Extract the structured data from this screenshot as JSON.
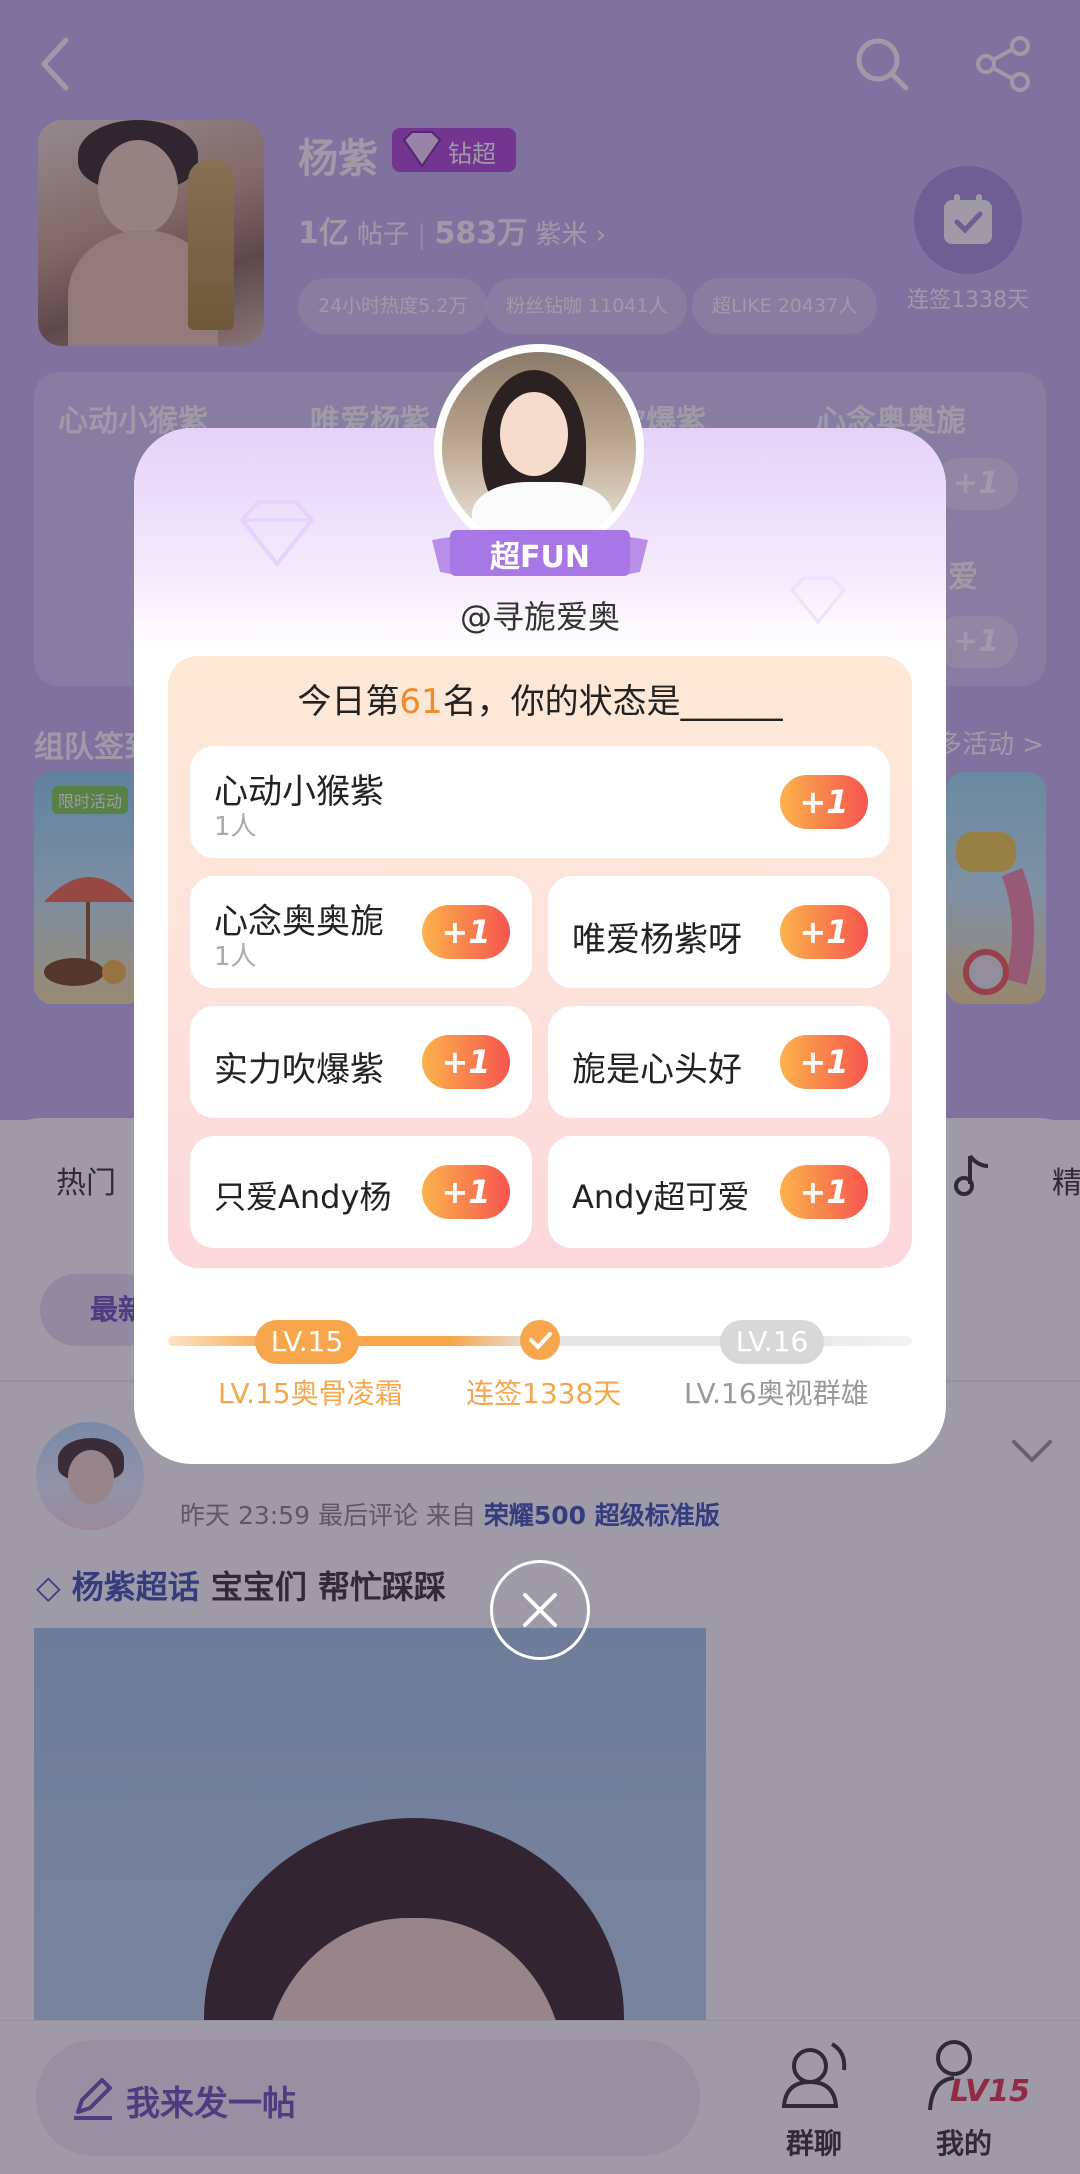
{
  "profile": {
    "name": "杨紫",
    "vip_label": "钻超",
    "posts_count": "1亿",
    "posts_label": "帖子",
    "fans_count": "583万",
    "fans_label": "紫米",
    "stat_pills": [
      "24小时热度5.2万",
      "粉丝钻咖 11041人",
      "超LIKE 20437人"
    ],
    "checkin_label": "连签1338天"
  },
  "tags_panel": {
    "items": [
      "心动小猴紫",
      "唯爱杨紫",
      "吹爆紫",
      "心念奥奥旎"
    ],
    "item_partial": "爱",
    "plus_label": "+1"
  },
  "team": {
    "title": "组队签到",
    "more_label": "多活动 >",
    "banner_tag": "限时活动"
  },
  "feed": {
    "tab_hot": "热门",
    "tab_more": "精",
    "filter_pill": "最新",
    "post_meta_time": "昨天 23:59 最后评论",
    "post_meta_from": "来自",
    "post_meta_device": "荣耀500 超级标准版",
    "post_topic": "杨紫超话",
    "post_text": "宝宝们 帮忙踩踩"
  },
  "bottom_bar": {
    "compose_label": "我来发一帖",
    "group_chat": "群聊",
    "mine": "我的",
    "level_badge": "LV15"
  },
  "modal": {
    "fun_badge": "超FUN",
    "handle": "@寻旎爱奥",
    "rank_prefix": "今日第",
    "rank_number": "61",
    "rank_suffix": "名，你的状态是______",
    "options": [
      {
        "label": "心动小猴紫",
        "count": "1人",
        "plus": "+1"
      },
      {
        "label": "心念奥奥旎",
        "count": "1人",
        "plus": "+1"
      },
      {
        "label": "唯爱杨紫呀",
        "count": "",
        "plus": "+1"
      },
      {
        "label": "实力吹爆紫",
        "count": "",
        "plus": "+1"
      },
      {
        "label": "旎是心头好",
        "count": "",
        "plus": "+1"
      },
      {
        "label": "只爱Andy杨",
        "count": "",
        "plus": "+1"
      },
      {
        "label": "Andy超可爱",
        "count": "",
        "plus": "+1"
      }
    ],
    "level": {
      "current_pill": "LV.15",
      "next_pill": "LV.16",
      "current_name": "LV.15奥骨凌霜",
      "streak": "连签1338天",
      "next_name": "LV.16奥视群雄"
    }
  },
  "colors": {
    "accent_purple": "#6a54b9",
    "orange": "#f7a64c",
    "plus_gradient_start": "#fbb34c",
    "plus_gradient_end": "#f6544e",
    "link_blue": "#3e55b4"
  },
  "icons": [
    "back-arrow-icon",
    "search-icon",
    "share-icon",
    "calendar-check-icon",
    "diamond-icon",
    "chevron-right-icon",
    "music-note-icon",
    "chevron-down-icon",
    "pencil-icon",
    "group-chat-icon",
    "person-icon",
    "close-icon",
    "check-icon"
  ]
}
